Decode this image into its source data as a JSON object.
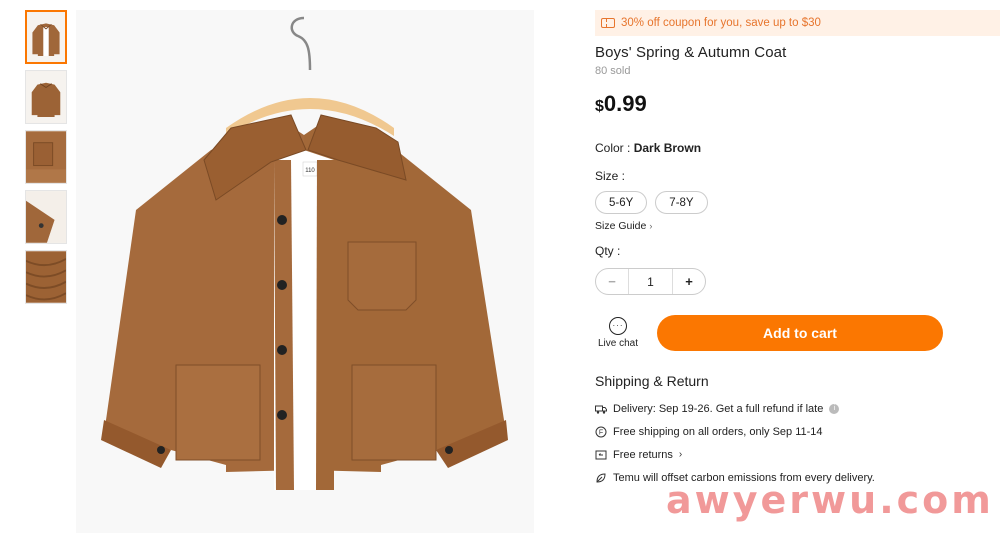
{
  "thumbnails": [
    {
      "alt": "coat-front",
      "active": true
    },
    {
      "alt": "coat-back",
      "active": false
    },
    {
      "alt": "coat-pocket-detail",
      "active": false
    },
    {
      "alt": "coat-sleeve-detail",
      "active": false
    },
    {
      "alt": "coat-fabric-detail",
      "active": false
    }
  ],
  "product": {
    "coupon_text": "30% off coupon for you, save up to $30",
    "title": "Boys' Spring & Autumn Coat",
    "sold": "80 sold",
    "currency": "$",
    "price": "0.99",
    "tag_number": "110",
    "color_label": "Color : ",
    "color_value": "Dark Brown",
    "size_label": "Size :",
    "sizes": [
      "5-6Y",
      "7-8Y"
    ],
    "size_guide": "Size Guide",
    "qty_label": "Qty :",
    "qty_value": "1",
    "qty_minus": "−",
    "qty_plus": "+",
    "live_chat": "Live chat",
    "add_to_cart": "Add to cart"
  },
  "shipping": {
    "title": "Shipping & Return",
    "items": [
      {
        "text": "Delivery: Sep 19-26. Get a full refund if late",
        "icon": "truck-icon"
      },
      {
        "text": "Free shipping on all orders, only Sep 11-14",
        "icon": "free-shipping-icon"
      },
      {
        "text": "Free returns",
        "icon": "returns-icon"
      },
      {
        "text": "Temu will offset carbon emissions from every delivery.",
        "icon": "leaf-icon"
      }
    ]
  },
  "watermark": "awyerwu.com",
  "colors": {
    "accent": "#fb7701",
    "coupon_bg": "#fff1e6",
    "coupon_text": "#e7752d",
    "coat_brown": "#a0673a"
  }
}
